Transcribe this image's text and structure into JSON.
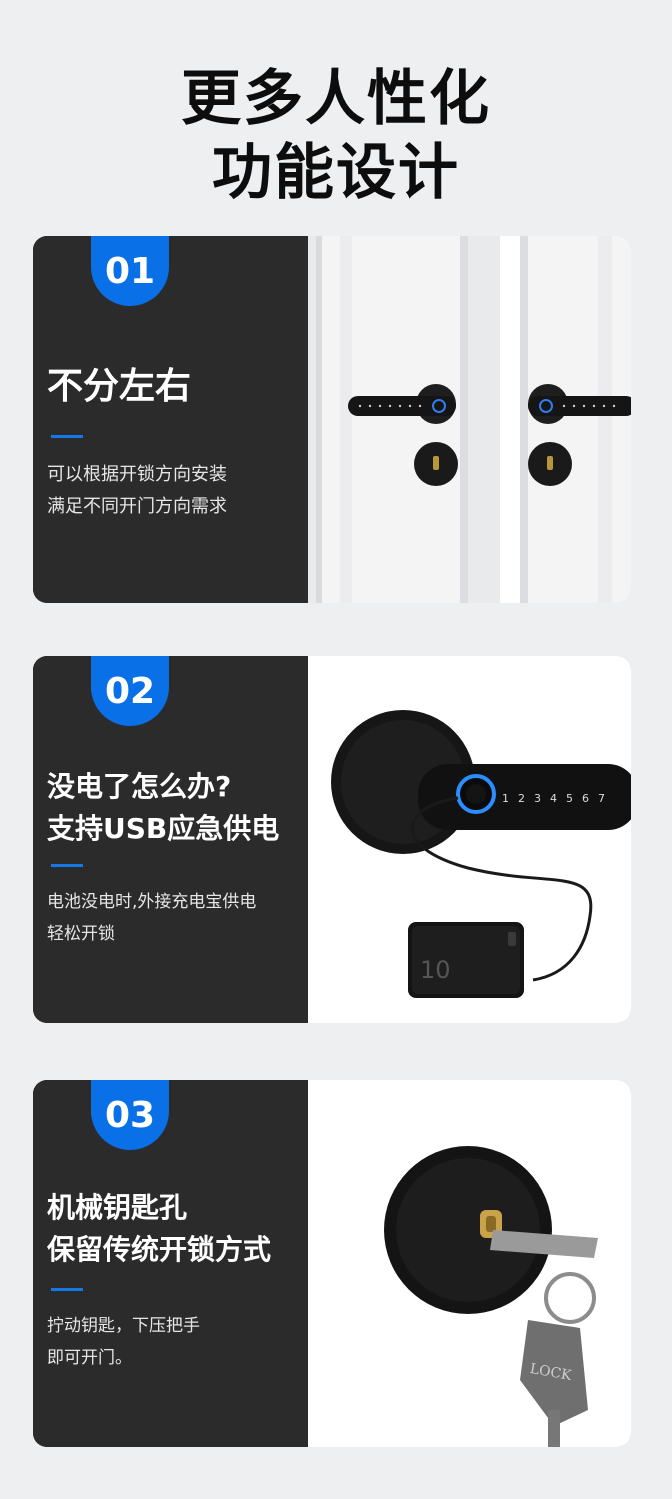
{
  "page": {
    "title_line1": "更多人性化",
    "title_line2": "功能设计"
  },
  "features": [
    {
      "number": "01",
      "heading": [
        "不分左右"
      ],
      "body": [
        "可以根据开锁方向安装",
        "满足不同开门方向需求"
      ]
    },
    {
      "number": "02",
      "heading": [
        "没电了怎么办?",
        "支持USB应急供电"
      ],
      "body": [
        "电池没电时,外接充电宝供电",
        "轻松开锁"
      ],
      "keypad_digits": [
        "1",
        "2",
        "3",
        "4",
        "5",
        "6",
        "7"
      ],
      "powerbank_text": "10"
    },
    {
      "number": "03",
      "heading": [
        "机械钥匙孔",
        "保留传统开锁方式"
      ],
      "body": [
        "拧动钥匙，下压把手",
        "即可开门。"
      ],
      "key_tag_text": "LOCK"
    }
  ],
  "colors": {
    "accent_blue": "#0a70e8",
    "card_dark": "#2b2b2b",
    "page_bg": "#eeeff1"
  }
}
